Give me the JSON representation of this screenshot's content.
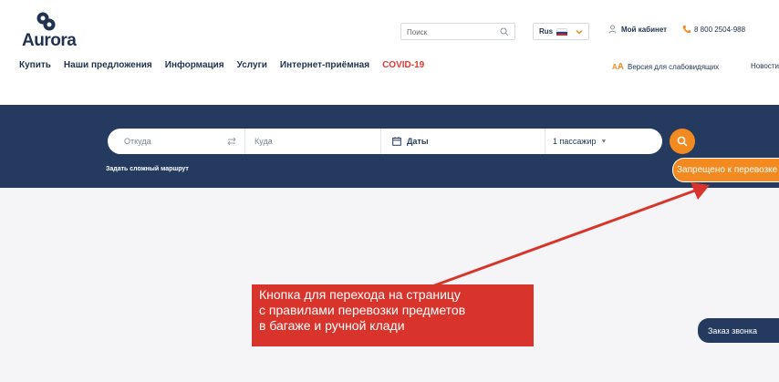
{
  "brand": {
    "logo_text": "Aurora"
  },
  "search": {
    "placeholder": "Поиск"
  },
  "language": {
    "label": "Rus"
  },
  "header": {
    "cabinet_label": "Мой кабинет",
    "phone": "8 800 2504-988"
  },
  "nav": {
    "items": [
      "Купить",
      "Наши предложения",
      "Информация",
      "Услуги",
      "Интернет-приёмная",
      "COVID-19"
    ]
  },
  "accessibility": {
    "icon_text_small": "A",
    "icon_text_large": "A",
    "label": "Версия для слабовидящих"
  },
  "news_label": "Новости",
  "flight_search": {
    "from_placeholder": "Откуда",
    "to_placeholder": "Куда",
    "dates_label": "Даты",
    "passengers_label": "1 пассажир",
    "complex_route_label": "Задать сложный маршрут"
  },
  "forbidden_button": {
    "label": "Запрещено к перевозке"
  },
  "callout": {
    "lines": [
      "Кнопка для перехода на страницу",
      "с правилами перевозки предметов",
      "в багаже и ручной клади"
    ]
  },
  "callback_button": {
    "label": "Заказ звонка"
  },
  "colors": {
    "navy": "#243a5e",
    "orange": "#f28a1f",
    "red": "#d9342b",
    "covid": "#e53935"
  }
}
